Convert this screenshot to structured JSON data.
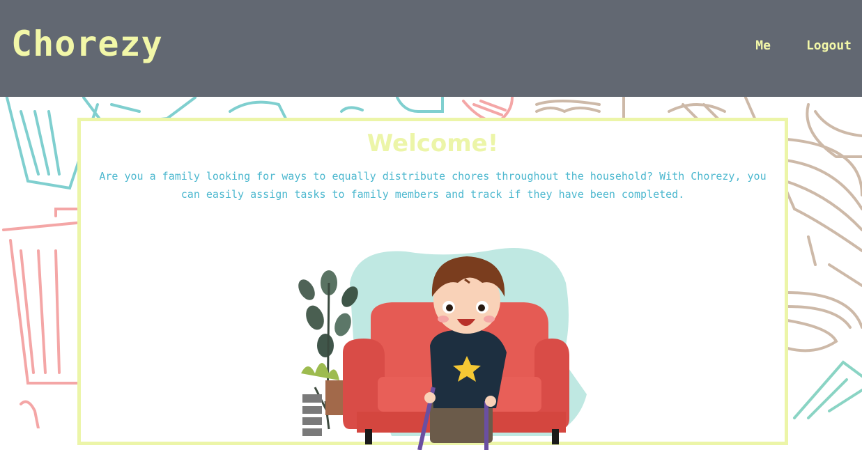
{
  "header": {
    "brand": "Chorezy",
    "nav": [
      {
        "label": "Me"
      },
      {
        "label": "Logout"
      }
    ]
  },
  "welcome": {
    "title": "Welcome!",
    "description": "Are you a family looking for ways to equally distribute chores throughout the household? With Chorezy, you can easily assign tasks to family members and track if they have been completed."
  },
  "colors": {
    "header_bg": "#626872",
    "accent": "#f2f7a8",
    "text_teal": "#4db8cf",
    "sofa": "#e55b54",
    "blob": "#bfe8e2"
  },
  "icons": [
    "laundry-basket-icon",
    "trash-can-icon",
    "whisk-icon",
    "cup-icon",
    "spray-bottle-icon",
    "plant-icon",
    "boy-illustration"
  ]
}
